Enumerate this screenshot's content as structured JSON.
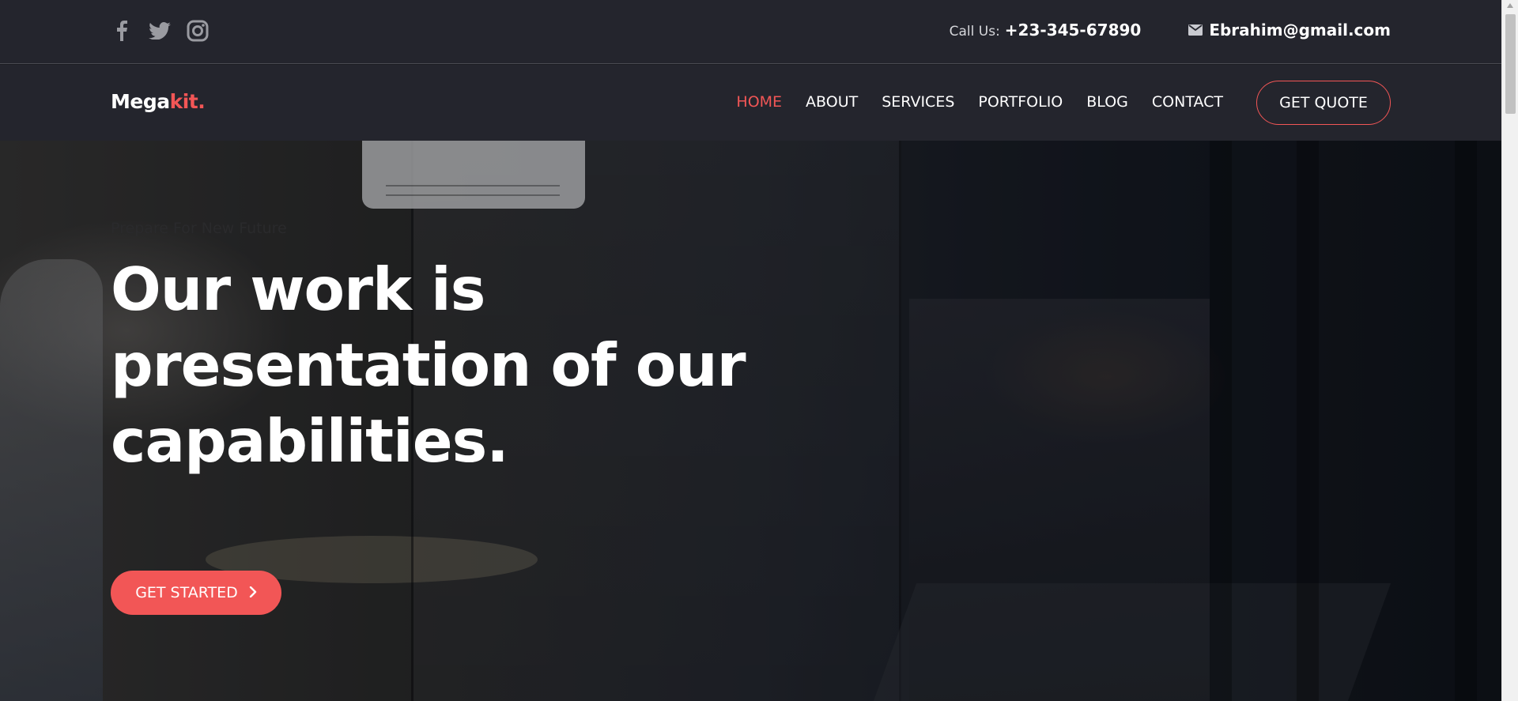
{
  "topbar": {
    "social": [
      {
        "icon": "facebook-icon"
      },
      {
        "icon": "twitter-icon"
      },
      {
        "icon": "instagram-icon"
      }
    ],
    "call_label": "Call Us:",
    "call_number": "+23-345-67890",
    "email": "Ebrahim@gmail.com"
  },
  "nav": {
    "logo_main": "Mega",
    "logo_accent": "kit.",
    "items": [
      {
        "label": "HOME",
        "active": true
      },
      {
        "label": "ABOUT"
      },
      {
        "label": "SERVICES"
      },
      {
        "label": "PORTFOLIO"
      },
      {
        "label": "BLOG"
      },
      {
        "label": "CONTACT"
      }
    ],
    "quote_button": "GET QUOTE"
  },
  "hero": {
    "kicker": "Prepare For New Future",
    "headline": "Our work is presentation of our capabilities.",
    "cta": "GET STARTED"
  },
  "colors": {
    "accent": "#f25656",
    "topbar_bg": "#24252d",
    "text": "#ffffff"
  }
}
